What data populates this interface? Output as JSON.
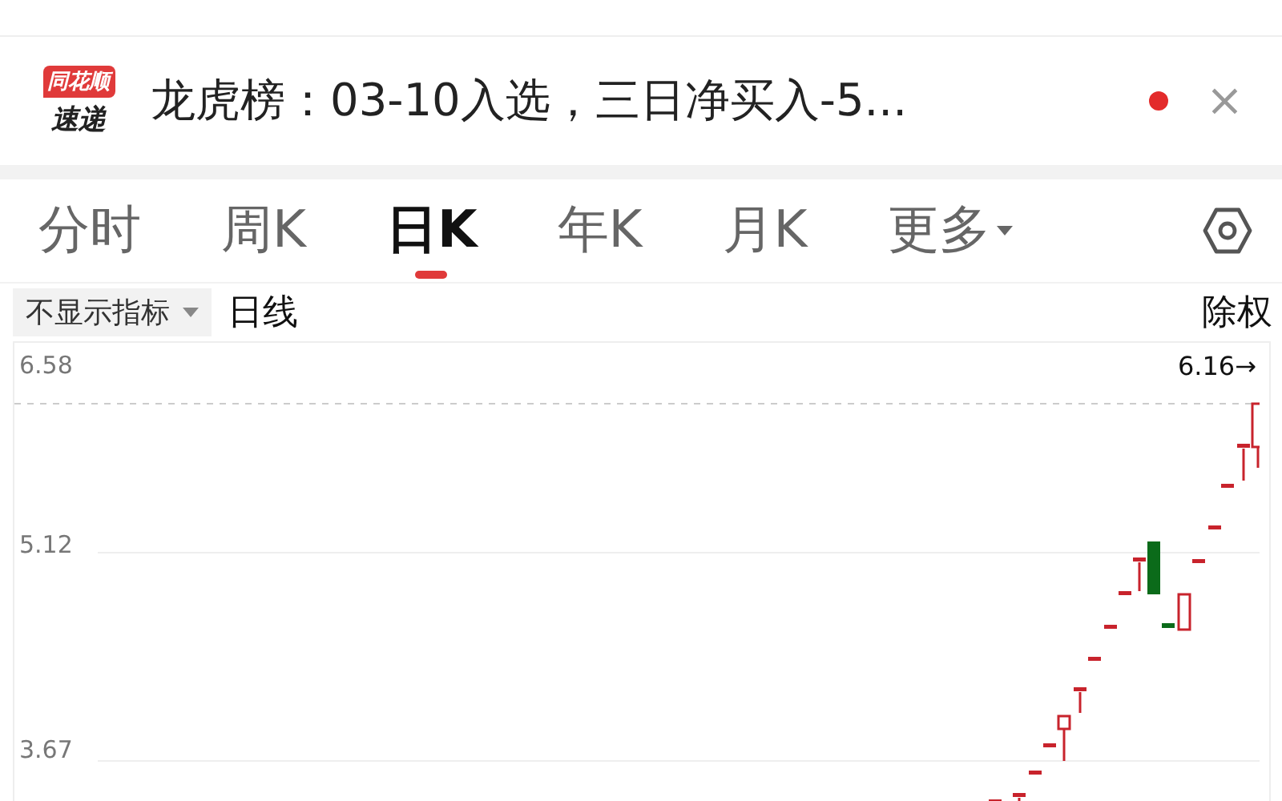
{
  "notification": {
    "logo_top": "同花顺",
    "logo_bottom": "速递",
    "title": "龙虎榜：03-10入选，三日净买入-5...",
    "unread": true,
    "close": "×"
  },
  "tabs": [
    {
      "label": "分时",
      "selected": false,
      "dropdown": false
    },
    {
      "label": "周K",
      "selected": false,
      "dropdown": false
    },
    {
      "label": "日K",
      "selected": true,
      "dropdown": false
    },
    {
      "label": "年K",
      "selected": false,
      "dropdown": false
    },
    {
      "label": "月K",
      "selected": false,
      "dropdown": false
    },
    {
      "label": "更多",
      "selected": false,
      "dropdown": true
    }
  ],
  "toolbar": {
    "indicator_button": "不显示指标",
    "chart_type": "日线",
    "adjust": "除权"
  },
  "chart": {
    "y_labels": [
      "6.58",
      "5.12",
      "3.67"
    ],
    "last_price": "6.16→"
  }
}
